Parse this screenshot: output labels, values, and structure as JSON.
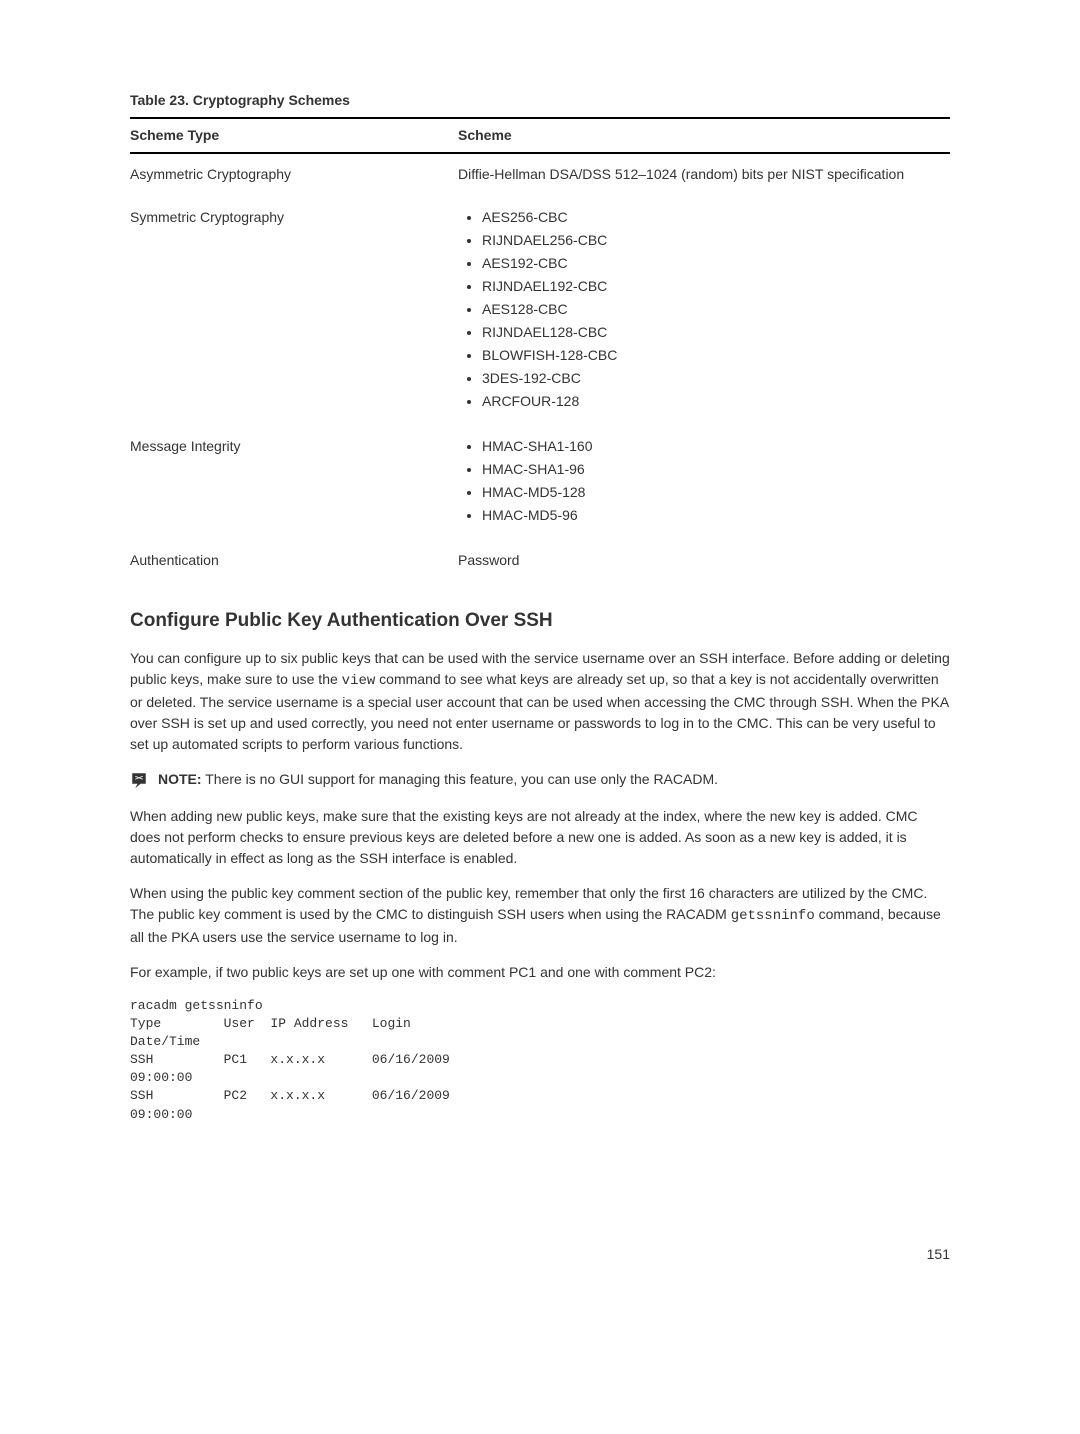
{
  "table": {
    "caption": "Table 23. Cryptography Schemes",
    "headers": [
      "Scheme Type",
      "Scheme"
    ],
    "rows": [
      {
        "type": "Asymmetric Cryptography",
        "scheme_text": "Diffie-Hellman DSA/DSS 512–1024 (random) bits per NIST specification"
      },
      {
        "type": "Symmetric Cryptography",
        "scheme_list": [
          "AES256-CBC",
          "RIJNDAEL256-CBC",
          "AES192-CBC",
          "RIJNDAEL192-CBC",
          "AES128-CBC",
          "RIJNDAEL128-CBC",
          "BLOWFISH-128-CBC",
          "3DES-192-CBC",
          "ARCFOUR-128"
        ]
      },
      {
        "type": "Message Integrity",
        "scheme_list": [
          "HMAC-SHA1-160",
          "HMAC-SHA1-96",
          "HMAC-MD5-128",
          "HMAC-MD5-96"
        ]
      },
      {
        "type": "Authentication",
        "scheme_text": "Password"
      }
    ]
  },
  "section_heading": "Configure Public Key Authentication Over SSH",
  "p1_a": "You can configure up to six public keys that can be used with the service username over an SSH interface. Before adding or deleting public keys, make sure to use the ",
  "p1_code": "view",
  "p1_b": " command to see what keys are already set up, so that a key is not accidentally overwritten or deleted. The service username is a special user account that can be used when accessing the CMC through SSH. When the PKA over SSH is set up and used correctly, you need not enter username or passwords to log in to the CMC. This can be very useful to set up automated scripts to perform various functions.",
  "note": {
    "label": "NOTE:",
    "text": " There is no GUI support for managing this feature, you can use only the RACADM."
  },
  "p2": "When adding new public keys, make sure that the existing keys are not already at the index, where the new key is added. CMC does not perform checks to ensure previous keys are deleted before a new one is added. As soon as a new key is added, it is automatically in effect as long as the SSH interface is enabled.",
  "p3_a": "When using the public key comment section of the public key, remember that only the first 16 characters are utilized by the CMC. The public key comment is used by the CMC to distinguish SSH users when using the RACADM ",
  "p3_code": "getssninfo",
  "p3_b": " command, because all the PKA users use the service username to log in.",
  "p4": "For example, if two public keys are set up one with comment PC1 and one with comment PC2:",
  "code_block": "racadm getssninfo\nType        User  IP Address   Login\nDate/Time\nSSH         PC1   x.x.x.x      06/16/2009\n09:00:00\nSSH         PC2   x.x.x.x      06/16/2009\n09:00:00",
  "page_number": "151"
}
